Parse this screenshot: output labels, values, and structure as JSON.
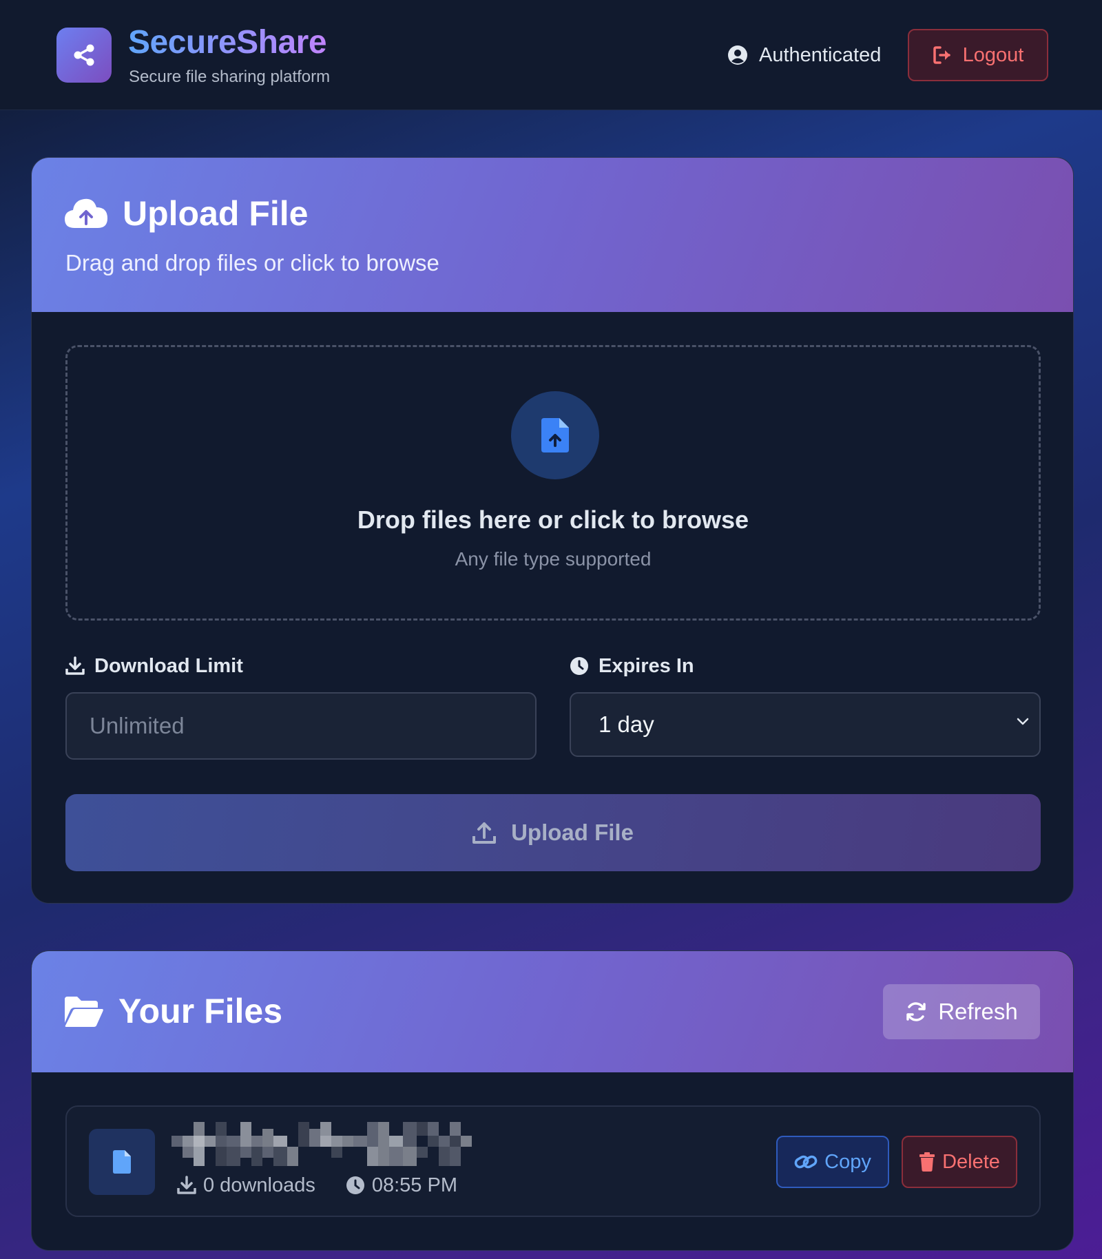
{
  "header": {
    "brand_title": "SecureShare",
    "brand_subtitle": "Secure file sharing platform",
    "auth_status": "Authenticated",
    "logout_label": "Logout"
  },
  "upload": {
    "title": "Upload File",
    "subtitle": "Drag and drop files or click to browse",
    "dropzone_title": "Drop files here or click to browse",
    "dropzone_subtitle": "Any file type supported",
    "download_limit_label": "Download Limit",
    "download_limit_placeholder": "Unlimited",
    "expires_label": "Expires In",
    "expires_value": "1 day",
    "submit_label": "Upload File"
  },
  "files": {
    "title": "Your Files",
    "refresh_label": "Refresh",
    "items": [
      {
        "downloads": "0 downloads",
        "time": "08:55 PM",
        "copy_label": "Copy",
        "delete_label": "Delete"
      }
    ]
  },
  "colors": {
    "accent_blue": "#60a5fa",
    "accent_purple": "#c084fc",
    "danger": "#f87171",
    "card_bg": "#111a2e"
  },
  "icons": {
    "logo": "share-nodes-icon",
    "auth": "user-circle-icon",
    "logout": "sign-out-icon",
    "upload_header": "cloud-upload-icon",
    "dropzone": "file-upload-icon",
    "download_limit": "download-icon",
    "expires": "clock-icon",
    "submit": "upload-icon",
    "files_header": "folder-open-icon",
    "refresh": "refresh-icon",
    "file": "file-icon",
    "copy": "link-icon",
    "delete": "trash-icon"
  }
}
